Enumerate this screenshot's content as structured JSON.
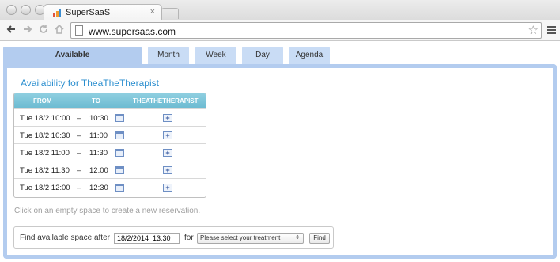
{
  "browser": {
    "tab_title": "SuperSaaS",
    "tab_close": "×",
    "url": "www.supersaas.com",
    "back_icon": "arrow-left-icon",
    "forward_icon": "arrow-right-icon",
    "reload_icon": "reload-icon",
    "home_icon": "home-icon",
    "star_icon": "star-icon",
    "menu_icon": "hamburger-menu-icon"
  },
  "tabs": [
    {
      "label": "Available",
      "active": true
    },
    {
      "label": "Month",
      "active": false
    },
    {
      "label": "Week",
      "active": false
    },
    {
      "label": "Day",
      "active": false
    },
    {
      "label": "Agenda",
      "active": false
    }
  ],
  "availability": {
    "title": "Availability for TheaTheTherapist",
    "columns": {
      "from": "FROM",
      "to": "TO",
      "resource": "THEATHETHERAPIST"
    },
    "rows": [
      {
        "from": "Tue 18/2 10:00",
        "dash": "–",
        "to": "10:30",
        "add": "+"
      },
      {
        "from": "Tue 18/2 10:30",
        "dash": "–",
        "to": "11:00",
        "add": "+"
      },
      {
        "from": "Tue 18/2 11:00",
        "dash": "–",
        "to": "11:30",
        "add": "+"
      },
      {
        "from": "Tue 18/2 11:30",
        "dash": "–",
        "to": "12:00",
        "add": "+"
      },
      {
        "from": "Tue 18/2 12:00",
        "dash": "–",
        "to": "12:30",
        "add": "+"
      }
    ]
  },
  "hint": "Click on an empty space to create a new reservation.",
  "finder": {
    "label": "Find available space after",
    "date_value": "18/2/2014  13:30",
    "for_label": "for",
    "treatment_selected": "Please select your treatment",
    "find_button": "Find"
  },
  "colors": {
    "accent": "#2a8ecf",
    "tab_bg": "#c9dcf5",
    "panel_bg": "#b3ccef",
    "table_header": "#6bbad1"
  }
}
